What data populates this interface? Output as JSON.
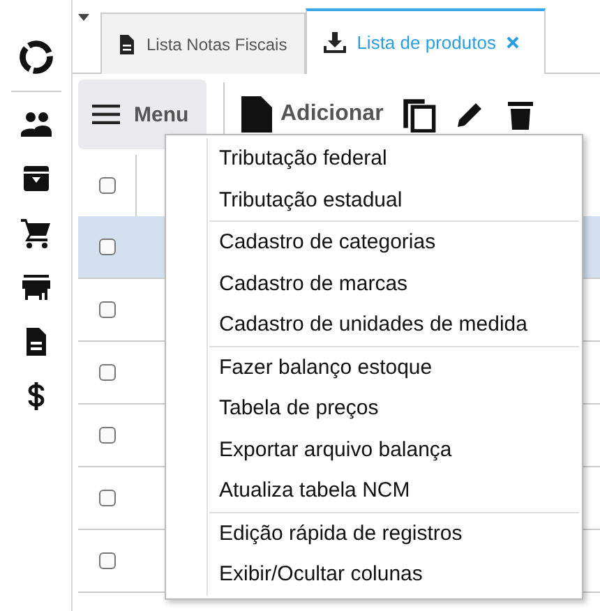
{
  "tabs": [
    {
      "label": "Lista Notas Fiscais",
      "kind": "document",
      "selected": false
    },
    {
      "label": "Lista de produtos",
      "kind": "download",
      "selected": true
    }
  ],
  "toolbar": {
    "menu_button": "Menu",
    "add_button": "Adicionar"
  },
  "table": {
    "header_checked": false,
    "rows": [
      {
        "selected": true,
        "checked": false
      },
      {
        "selected": false,
        "checked": false
      },
      {
        "selected": false,
        "checked": false
      },
      {
        "selected": false,
        "checked": false
      },
      {
        "selected": false,
        "checked": false
      },
      {
        "selected": false,
        "checked": false
      }
    ]
  },
  "context_menu": {
    "groups": [
      [
        "Tributação federal",
        "Tributação estadual"
      ],
      [
        "Cadastro de categorias",
        "Cadastro de marcas",
        "Cadastro de unidades de medida"
      ],
      [
        "Fazer balanço estoque",
        "Tabela de preços",
        "Exportar arquivo balança",
        "Atualiza tabela NCM"
      ],
      [
        "Edição rápida de registros",
        "Exibir/Ocultar colunas"
      ]
    ]
  }
}
